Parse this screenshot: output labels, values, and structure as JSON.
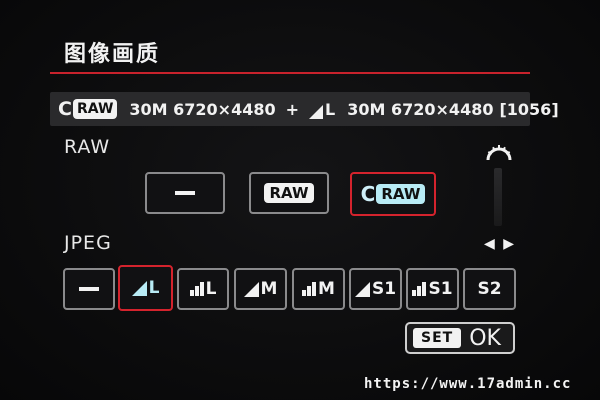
{
  "header": {
    "title": "图像画质"
  },
  "info_bar": {
    "c_letter": "C",
    "raw_badge": "RAW",
    "raw_spec": "30M 6720×4480",
    "plus": "+",
    "jpeg_quality": "L",
    "jpeg_spec": "30M 6720×4480",
    "shots_remaining": "[1056]"
  },
  "raw_section": {
    "label": "RAW",
    "options": [
      {
        "id": "none",
        "label": "",
        "icon": "dash-icon",
        "selected": false
      },
      {
        "id": "raw",
        "label": "RAW",
        "selected": false
      },
      {
        "id": "craw",
        "c_letter": "C",
        "label": "RAW",
        "selected": true
      }
    ]
  },
  "jpeg_section": {
    "label": "JPEG",
    "arrows": "◀ ▶",
    "options": [
      {
        "id": "none",
        "label": "",
        "icon": "dash-icon",
        "selected": false
      },
      {
        "id": "l-fine",
        "label": "L",
        "icon": "fine-triangle-icon",
        "selected": true
      },
      {
        "id": "l-normal",
        "label": "L",
        "icon": "normal-steps-icon",
        "selected": false
      },
      {
        "id": "m-fine",
        "label": "M",
        "icon": "fine-triangle-icon",
        "selected": false
      },
      {
        "id": "m-normal",
        "label": "M",
        "icon": "normal-steps-icon",
        "selected": false
      },
      {
        "id": "s1-fine",
        "label": "S1",
        "icon": "fine-triangle-icon",
        "selected": false
      },
      {
        "id": "s1-normal",
        "label": "S1",
        "icon": "normal-steps-icon",
        "selected": false
      },
      {
        "id": "s2",
        "label": "S2",
        "icon": "",
        "selected": false
      }
    ]
  },
  "footer": {
    "set_label": "SET",
    "ok_label": "OK"
  },
  "watermark": "https://www.17admin.cc",
  "colors": {
    "selection": "#d4232d",
    "accent_cyan": "#b8ebf5",
    "rule": "#c8222c"
  }
}
